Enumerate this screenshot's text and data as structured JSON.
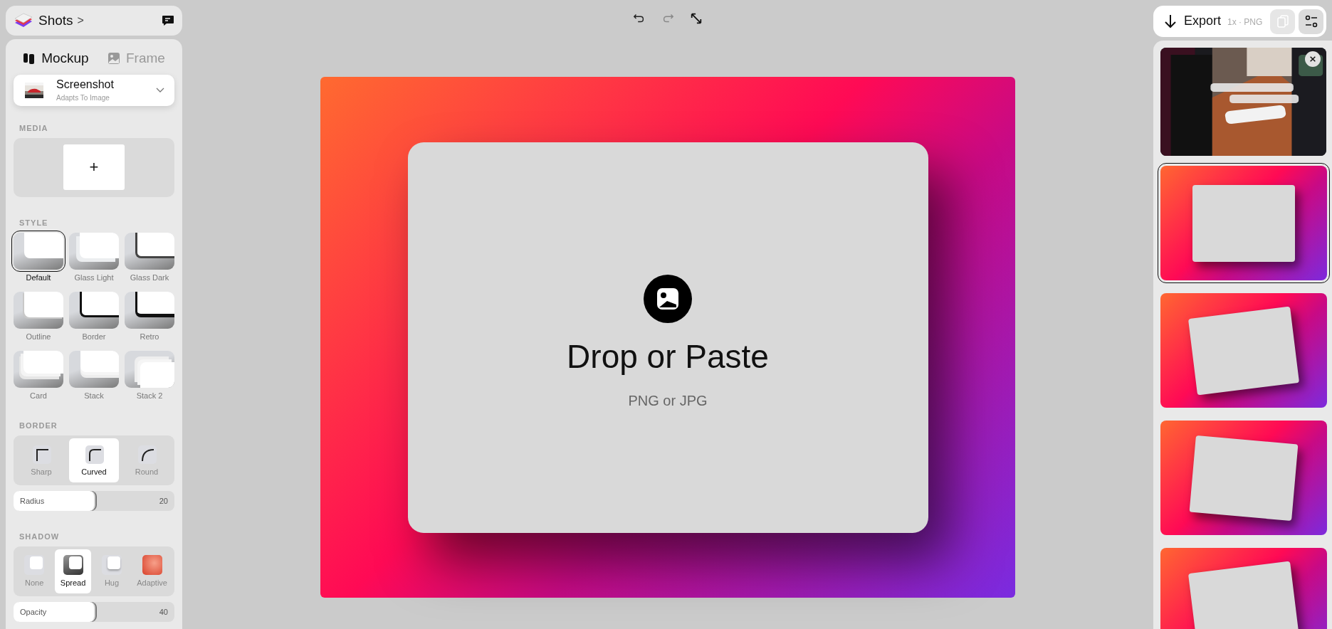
{
  "app": {
    "name": "Shots",
    "chevron": ">"
  },
  "mode_tabs": [
    {
      "label": "Mockup",
      "selected": true,
      "kind": "mockup"
    },
    {
      "label": "Frame",
      "selected": false,
      "kind": "frame"
    }
  ],
  "device": {
    "name": "Screenshot",
    "subtitle": "Adapts To Image"
  },
  "media": {
    "title": "MEDIA",
    "add": "+"
  },
  "style": {
    "title": "STYLE",
    "options": [
      {
        "label": "Default",
        "kind": "default",
        "selected": true
      },
      {
        "label": "Glass Light",
        "kind": "glass-light",
        "selected": false
      },
      {
        "label": "Glass Dark",
        "kind": "glass-dark",
        "selected": false
      },
      {
        "label": "Outline",
        "kind": "outline",
        "selected": false
      },
      {
        "label": "Border",
        "kind": "border",
        "selected": false
      },
      {
        "label": "Retro",
        "kind": "retro",
        "selected": false
      },
      {
        "label": "Card",
        "kind": "card",
        "selected": false
      },
      {
        "label": "Stack",
        "kind": "stack",
        "selected": false
      },
      {
        "label": "Stack 2",
        "kind": "stack2",
        "selected": false
      }
    ]
  },
  "border": {
    "title": "BORDER",
    "options": [
      {
        "label": "Sharp",
        "kind": "sharp",
        "selected": false
      },
      {
        "label": "Curved",
        "kind": "curved",
        "selected": true
      },
      {
        "label": "Round",
        "kind": "round",
        "selected": false
      }
    ],
    "slider": {
      "label": "Radius",
      "value": "20",
      "level": 0.5
    }
  },
  "shadow": {
    "title": "SHADOW",
    "options": [
      {
        "label": "None",
        "kind": "none",
        "selected": false
      },
      {
        "label": "Spread",
        "kind": "spread",
        "selected": true
      },
      {
        "label": "Hug",
        "kind": "hug",
        "selected": false
      },
      {
        "label": "Adaptive",
        "kind": "adaptive",
        "selected": false
      }
    ],
    "slider": {
      "label": "Opacity",
      "value": "40",
      "level": 0.5
    }
  },
  "canvas": {
    "title": "Drop or Paste",
    "subtitle": "PNG or JPG"
  },
  "export": {
    "label": "Export",
    "format": "1x · PNG"
  },
  "presets": [
    {
      "kind": "picture",
      "selected": false
    },
    {
      "kind": "straight",
      "selected": true
    },
    {
      "kind": "tilt-left",
      "selected": false
    },
    {
      "kind": "tilt-right",
      "selected": false
    },
    {
      "kind": "tilt-left",
      "selected": false
    }
  ]
}
